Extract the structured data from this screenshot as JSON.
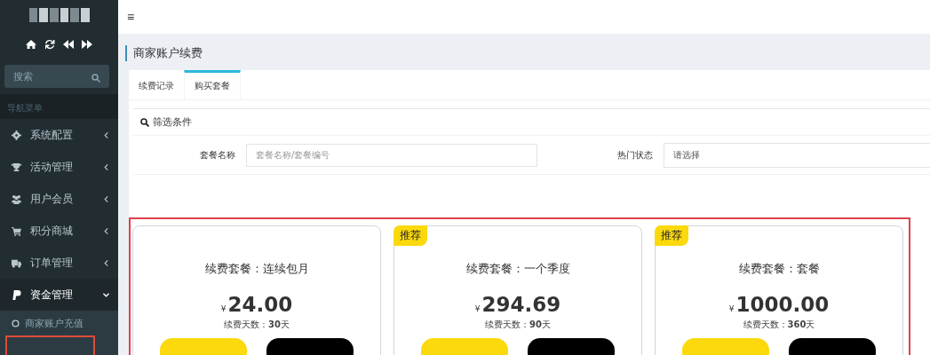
{
  "sidebar": {
    "search": {
      "placeholder": "搜索"
    },
    "nav_header": "导航菜单",
    "items": [
      {
        "label": "系统配置",
        "expanded": false
      },
      {
        "label": "活动管理",
        "expanded": false
      },
      {
        "label": "用户会员",
        "expanded": false
      },
      {
        "label": "积分商城",
        "expanded": false
      },
      {
        "label": "订单管理",
        "expanded": false
      },
      {
        "label": "资金管理",
        "expanded": true,
        "children": [
          {
            "label": "商家账户充值"
          }
        ]
      }
    ]
  },
  "topbar": {
    "menu": "≡"
  },
  "page_title": "商家账户续费",
  "tabs": [
    {
      "label": "续费记录",
      "selected": false
    },
    {
      "label": "购买套餐",
      "selected": true
    }
  ],
  "filter": {
    "title": "筛选条件",
    "fields": [
      {
        "kind": "input",
        "label": "套餐名称",
        "placeholder": "套餐名称/套餐编号"
      },
      {
        "kind": "select",
        "label": "热门状态",
        "value": "请选择"
      }
    ]
  },
  "plans": [
    {
      "title": "续费套餐：连续包月",
      "currency": "¥",
      "price": "24.00",
      "days": "续费天数：**30**天"
    },
    {
      "badge": "推荐",
      "title": "续费套餐：一个季度",
      "currency": "¥",
      "price": "294.69",
      "days": "续费天数：**90**天"
    },
    {
      "badge": "推荐",
      "title": "续费套餐：套餐",
      "currency": "¥",
      "price": "1000.00",
      "days": "续费天数：**360**天"
    }
  ]
}
